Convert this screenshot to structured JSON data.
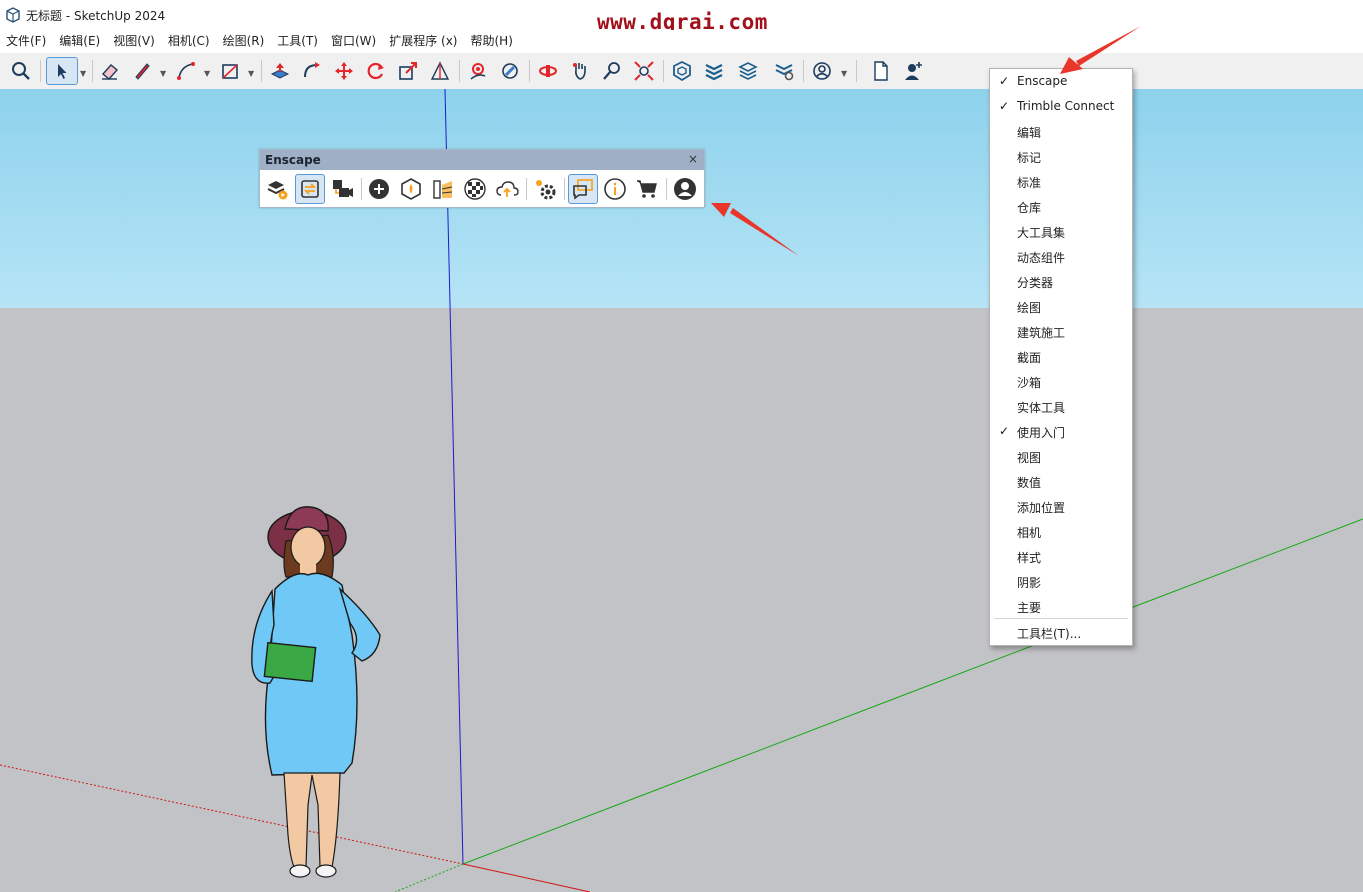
{
  "window": {
    "title": "无标题 - SketchUp 2024",
    "app_icon": "sketchup-logo-icon"
  },
  "watermark": "www.dgrai.com",
  "menu": [
    {
      "label": "文件(F)"
    },
    {
      "label": "编辑(E)"
    },
    {
      "label": "视图(V)"
    },
    {
      "label": "相机(C)"
    },
    {
      "label": "绘图(R)"
    },
    {
      "label": "工具(T)"
    },
    {
      "label": "窗口(W)"
    },
    {
      "label": "扩展程序 (x)"
    },
    {
      "label": "帮助(H)"
    }
  ],
  "toolbar": {
    "tools": [
      "search-icon",
      "select-arrow-icon",
      "eraser-icon",
      "pencil-line-icon",
      "arc-icon",
      "rectangle-icon",
      "push-pull-icon",
      "follow-me-icon",
      "move-icon",
      "rotate-icon",
      "scale-icon",
      "tape-measure-icon",
      "orbit-icon",
      "section-plane-icon",
      "pan-icon",
      "zoom-icon",
      "zoom-extents-icon",
      "warehouse-icon",
      "extension-warehouse-icon",
      "layout-icon",
      "trimble-icon",
      "account-icon",
      "new-file-icon",
      "add-user-icon"
    ],
    "active_tool": "select-arrow-icon"
  },
  "enscape_panel": {
    "title": "Enscape",
    "close_glyph": "×",
    "buttons": [
      "start-enscape-icon",
      "sync-icon",
      "video-capture-icon",
      "add-icon",
      "views-icon",
      "materials-icon",
      "checker-icon",
      "upload-cloud-icon",
      "settings-icon",
      "feedback-icon",
      "info-icon",
      "cart-icon",
      "user-account-icon"
    ],
    "active_buttons": [
      "sync-icon",
      "feedback-icon"
    ]
  },
  "context_menu": {
    "items": [
      {
        "label": "Enscape",
        "checked": true
      },
      {
        "label": "Trimble Connect",
        "checked": true
      },
      {
        "label": "编辑",
        "checked": false
      },
      {
        "label": "标记",
        "checked": false
      },
      {
        "label": "标准",
        "checked": false
      },
      {
        "label": "仓库",
        "checked": false
      },
      {
        "label": "大工具集",
        "checked": false
      },
      {
        "label": "动态组件",
        "checked": false
      },
      {
        "label": "分类器",
        "checked": false
      },
      {
        "label": "绘图",
        "checked": false
      },
      {
        "label": "建筑施工",
        "checked": false
      },
      {
        "label": "截面",
        "checked": false
      },
      {
        "label": "沙箱",
        "checked": false
      },
      {
        "label": "实体工具",
        "checked": false
      },
      {
        "label": "使用入门",
        "checked": true
      },
      {
        "label": "视图",
        "checked": false
      },
      {
        "label": "数值",
        "checked": false
      },
      {
        "label": "添加位置",
        "checked": false
      },
      {
        "label": "相机",
        "checked": false
      },
      {
        "label": "样式",
        "checked": false
      },
      {
        "label": "阴影",
        "checked": false
      },
      {
        "label": "主要",
        "checked": false
      }
    ],
    "footer": "工具栏(T)...",
    "check_glyph": "✓"
  },
  "colors": {
    "sky": "#8dd2ec",
    "ground": "#c2c3c6",
    "x_axis": "#cc0000",
    "y_axis": "#00a000",
    "z_axis": "#0000cc",
    "annotation_arrow": "#e8372a",
    "watermark": "#a1111b",
    "person_dress": "#6fc8f5",
    "person_hat": "#7c3046",
    "person_book": "#3aa845"
  }
}
